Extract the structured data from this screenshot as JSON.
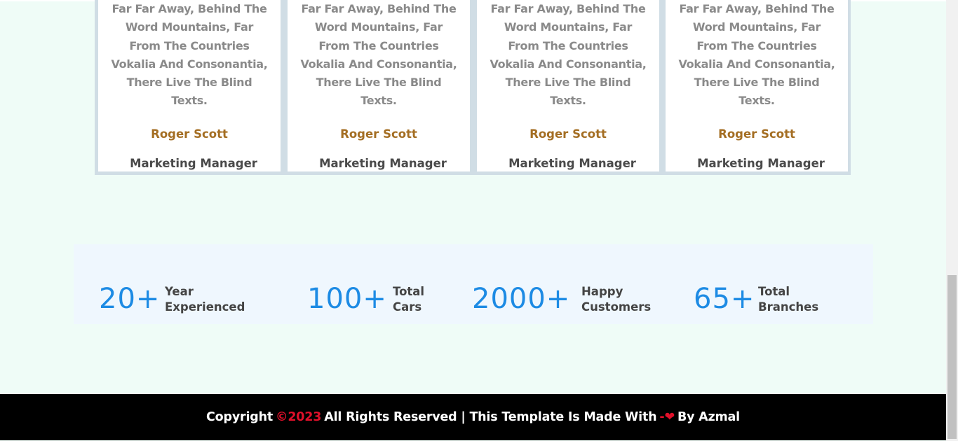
{
  "testimonials": {
    "cards": [
      {
        "lines": [
          "Far Far Away, Behind The",
          "Word Mountains, Far",
          "From The Countries",
          "Vokalia And Consonantia,",
          "There Live The Blind",
          "Texts."
        ],
        "name": "Roger Scott",
        "role": "Marketing Manager"
      },
      {
        "lines": [
          "Far Far Away, Behind The",
          "Word Mountains, Far",
          "From The Countries",
          "Vokalia And Consonantia,",
          "There Live The Blind",
          "Texts."
        ],
        "name": "Roger Scott",
        "role": "Marketing Manager"
      },
      {
        "lines": [
          "Far Far Away, Behind The",
          "Word Mountains, Far",
          "From The Countries",
          "Vokalia And Consonantia,",
          "There Live The Blind",
          "Texts."
        ],
        "name": "Roger Scott",
        "role": "Marketing Manager"
      },
      {
        "lines": [
          "Far Far Away, Behind The",
          "Word Mountains, Far",
          "From The Countries",
          "Vokalia And Consonantia,",
          "There Live The Blind",
          "Texts."
        ],
        "name": "Roger Scott",
        "role": "Marketing Manager"
      }
    ]
  },
  "stats": [
    {
      "number": "20+",
      "label_line1": "Year",
      "label_line2": "Experienced"
    },
    {
      "number": "100+",
      "label_line1": "Total",
      "label_line2": "Cars"
    },
    {
      "number": "2000+",
      "label_line1": "Happy",
      "label_line2": "Customers"
    },
    {
      "number": "65+",
      "label_line1": "Total",
      "label_line2": "Branches"
    }
  ],
  "footer": {
    "prefix": "Copyright",
    "year": "©2023",
    "middle": "All Rights Reserved | This Template Is Made With",
    "dash": "-",
    "heart_icon": "heart-icon",
    "by": "By Azmal"
  },
  "colors": {
    "background": "#effcf7",
    "accent_blue": "#1d8be4",
    "name_gold": "#a46e23",
    "heart_red": "#e0102a"
  }
}
